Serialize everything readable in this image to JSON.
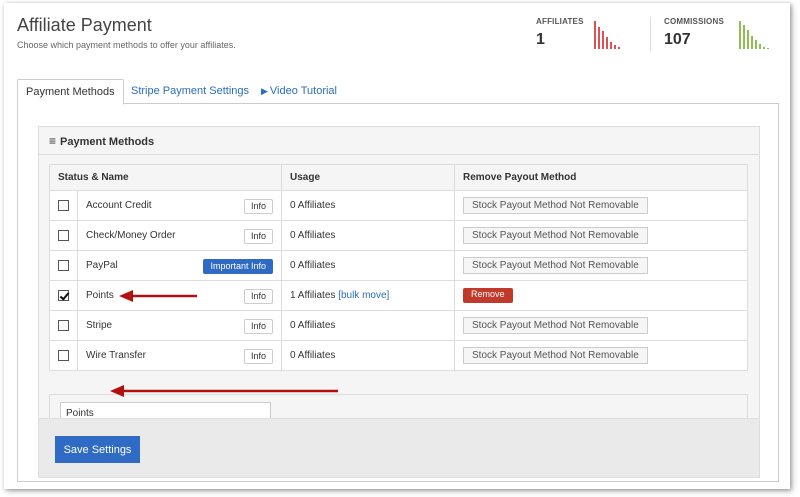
{
  "header": {
    "title": "Affiliate Payment",
    "subtitle": "Choose which payment methods to offer your affiliates."
  },
  "stats": [
    {
      "label": "AFFILIATES",
      "value": "1",
      "color": "#e05050"
    },
    {
      "label": "COMMISSIONS",
      "value": "107",
      "color": "#8fbf4f"
    }
  ],
  "tabs": [
    {
      "label": "Payment Methods",
      "active": true
    },
    {
      "label": "Stripe Payment Settings",
      "active": false
    },
    {
      "label": "Video Tutorial",
      "active": false,
      "icon": "play-icon"
    }
  ],
  "panel": {
    "title": "Payment Methods",
    "icon": "menu-icon",
    "columns": [
      "Status & Name",
      "Usage",
      "Remove Payout Method"
    ],
    "rows": [
      {
        "name": "Account Credit",
        "checked": false,
        "info": "Info",
        "info_style": "default",
        "usage": "0 Affiliates",
        "remove": "Stock Payout Method Not Removable"
      },
      {
        "name": "Check/Money Order",
        "checked": false,
        "info": "Info",
        "info_style": "default",
        "usage": "0 Affiliates",
        "remove": "Stock Payout Method Not Removable"
      },
      {
        "name": "PayPal",
        "checked": false,
        "info": "Important Info",
        "info_style": "primary",
        "usage": "0 Affiliates",
        "remove": "Stock Payout Method Not Removable"
      },
      {
        "name": "Points",
        "checked": true,
        "info": "Info",
        "info_style": "default",
        "usage": "1 Affiliates",
        "usage_link": "[bulk move]",
        "remove": "Remove"
      },
      {
        "name": "Stripe",
        "checked": false,
        "info": "Info",
        "info_style": "default",
        "usage": "0 Affiliates",
        "remove": "Stock Payout Method Not Removable"
      },
      {
        "name": "Wire Transfer",
        "checked": false,
        "info": "Info",
        "info_style": "default",
        "usage": "0 Affiliates",
        "remove": "Stock Payout Method Not Removable"
      }
    ],
    "new_method_input": "Points",
    "save_label": "Save Settings"
  },
  "colors": {
    "accent_blue": "#2f6bc4",
    "remove_red": "#c0392b",
    "annotation_arrow": "#b01010"
  }
}
